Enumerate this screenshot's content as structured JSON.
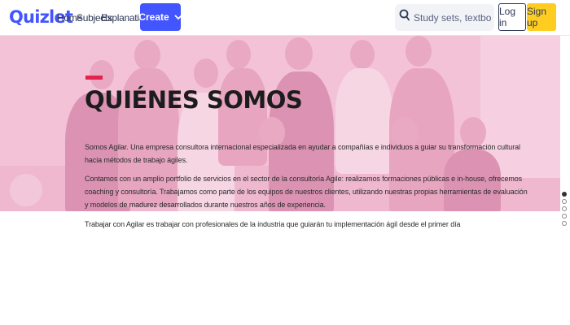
{
  "header": {
    "logo": "Quizlet",
    "nav": {
      "home": "Home",
      "subjects": "Subjects",
      "explanations": "Explanations"
    },
    "create_label": "Create",
    "search_placeholder": "Study sets, textbooks, ...",
    "login_label": "Log in",
    "signup_label": "Sign up"
  },
  "hero": {
    "title": "QUIÉNES SOMOS",
    "paragraph1_line1": "Somos Agilar. Una empresa consultora internacional especializada en ayudar a compañías e individuos a guiar su transformación cultural",
    "paragraph1_line2": "hacia métodos de trabajo ágiles.",
    "paragraph2_line1": "Contamos con un amplio portfolio de servicios en el sector de la consultoría Agile: realizamos formaciones públicas e in-house, ofrecemos",
    "paragraph2_line2": "coaching y consultoría. Trabajamos como parte de los equipos de nuestros clientes, utilizando nuestras propias herramientas de evaluación",
    "paragraph2_line3": "y modelos de madurez desarrollados durante nuestros años de experiencia.",
    "paragraph3": "Trabajar con Agilar es trabajar con profesionales de la industria que guiarán tu implementación ágil desde el primer día"
  },
  "pager": {
    "count": 5,
    "active_index": 0
  },
  "colors": {
    "brand": "#4255ff",
    "signup": "#ffcd1f",
    "hero_bg": "#f4c2d6",
    "accent": "#e0244b"
  }
}
